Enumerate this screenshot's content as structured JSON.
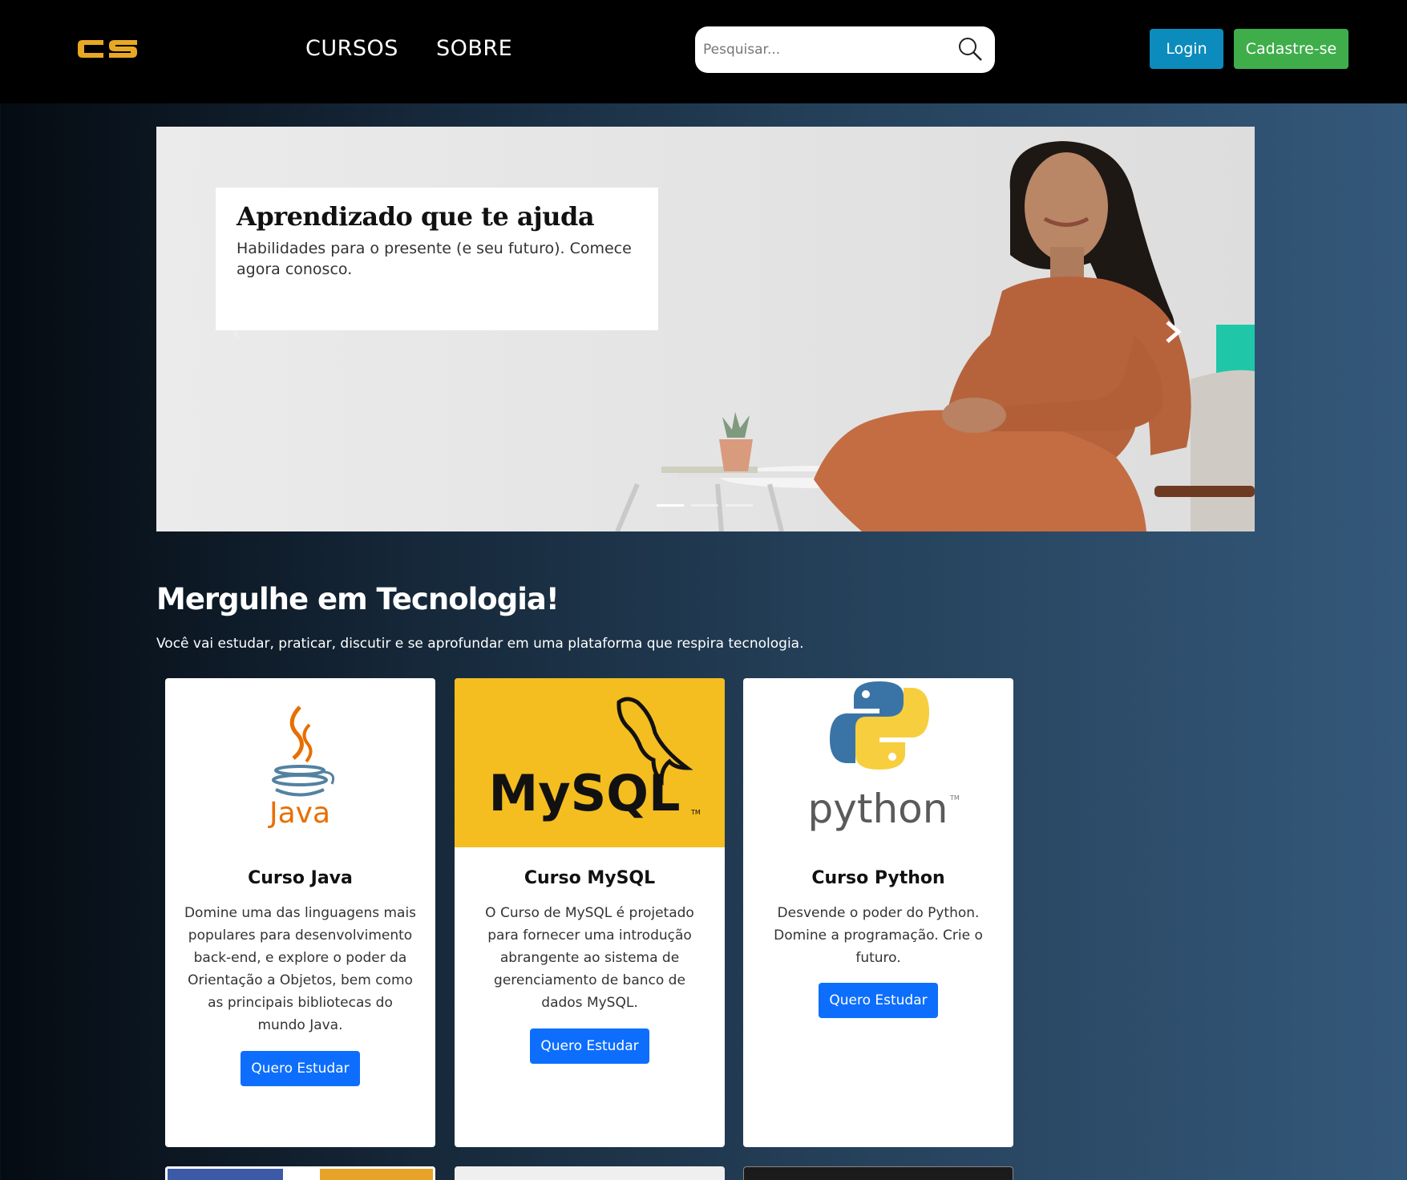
{
  "navbar": {
    "logo_text": "CS",
    "links": [
      "CURSOS",
      "SOBRE"
    ],
    "search_placeholder": "Pesquisar...",
    "login_label": "Login",
    "signup_label": "Cadastre-se"
  },
  "carousel": {
    "caption_title": "Aprendizado que te ajuda",
    "caption_text": "Habilidades para o presente (e seu futuro). Comece agora conosco.",
    "slide_count": 3,
    "active_slide": 1
  },
  "section": {
    "title": "Mergulhe em Tecnologia!",
    "subtitle": "Você vai estudar, praticar, discutir e se aprofundar em uma plataforma que respira tecnologia."
  },
  "courses": [
    {
      "logo_text": "Java",
      "title": "Curso Java",
      "description": "Domine uma das linguagens mais populares para desenvolvimento back-end, e explore o poder da Orientação a Objetos, bem como as principais bibliotecas do mundo Java.",
      "button": "Quero Estudar"
    },
    {
      "logo_text": "MySQL",
      "title": "Curso MySQL",
      "description": "O Curso de MySQL é projetado para fornecer uma introdução abrangente ao sistema de gerenciamento de banco de dados MySQL.",
      "button": "Quero Estudar"
    },
    {
      "logo_text": "python",
      "title": "Curso Python",
      "description": "Desvende o poder do Python. Domine a programação. Crie o futuro.",
      "button": "Quero Estudar"
    }
  ],
  "colors": {
    "navbar_bg": "#000000",
    "logo": "#e8a823",
    "login_btn": "#0c8bbd",
    "signup_btn": "#3fae4a",
    "primary_btn": "#0d6efd",
    "mysql_bg": "#f4bd20",
    "python_blue": "#3a74a6",
    "python_yellow": "#f7ce3e"
  }
}
